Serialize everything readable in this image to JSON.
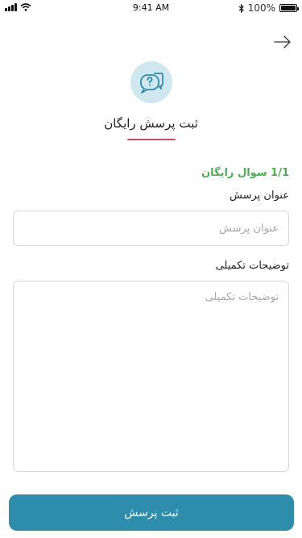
{
  "status_bar": {
    "time": "9:41 AM",
    "battery": "100%",
    "battery_level": 1.0
  },
  "header": {
    "back_icon": "arrow-right-icon",
    "hero_icon": "question-chat-bubbles-icon",
    "title": "ثبت پرسش رایگان"
  },
  "form": {
    "counter": "1/1 سوال رایگان",
    "title_label": "عنوان پرسش",
    "title_placeholder": "عنوان پرسش",
    "title_value": "",
    "desc_label": "توضیحات تکمیلی",
    "desc_placeholder": "توضیحات تکمیلی",
    "desc_value": ""
  },
  "submit": {
    "label": "ثبت پرسش"
  },
  "colors": {
    "accent": "#2d8dab",
    "hero_bg": "#cfe8ef",
    "underline": "#d64a63",
    "counter": "#4caf50"
  }
}
